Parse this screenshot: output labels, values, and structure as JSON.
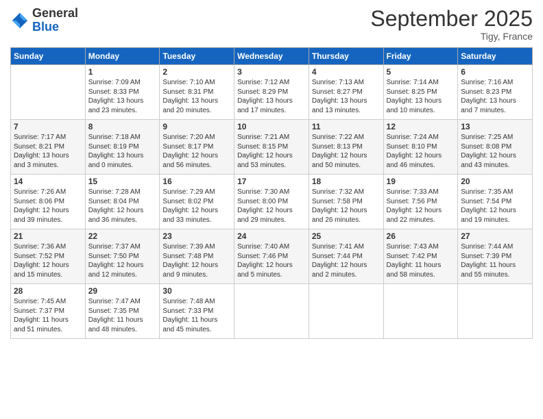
{
  "logo": {
    "general": "General",
    "blue": "Blue"
  },
  "title": "September 2025",
  "location": "Tigy, France",
  "days_header": [
    "Sunday",
    "Monday",
    "Tuesday",
    "Wednesday",
    "Thursday",
    "Friday",
    "Saturday"
  ],
  "weeks": [
    [
      {
        "day": "",
        "text": ""
      },
      {
        "day": "1",
        "text": "Sunrise: 7:09 AM\nSunset: 8:33 PM\nDaylight: 13 hours\nand 23 minutes."
      },
      {
        "day": "2",
        "text": "Sunrise: 7:10 AM\nSunset: 8:31 PM\nDaylight: 13 hours\nand 20 minutes."
      },
      {
        "day": "3",
        "text": "Sunrise: 7:12 AM\nSunset: 8:29 PM\nDaylight: 13 hours\nand 17 minutes."
      },
      {
        "day": "4",
        "text": "Sunrise: 7:13 AM\nSunset: 8:27 PM\nDaylight: 13 hours\nand 13 minutes."
      },
      {
        "day": "5",
        "text": "Sunrise: 7:14 AM\nSunset: 8:25 PM\nDaylight: 13 hours\nand 10 minutes."
      },
      {
        "day": "6",
        "text": "Sunrise: 7:16 AM\nSunset: 8:23 PM\nDaylight: 13 hours\nand 7 minutes."
      }
    ],
    [
      {
        "day": "7",
        "text": "Sunrise: 7:17 AM\nSunset: 8:21 PM\nDaylight: 13 hours\nand 3 minutes."
      },
      {
        "day": "8",
        "text": "Sunrise: 7:18 AM\nSunset: 8:19 PM\nDaylight: 13 hours\nand 0 minutes."
      },
      {
        "day": "9",
        "text": "Sunrise: 7:20 AM\nSunset: 8:17 PM\nDaylight: 12 hours\nand 56 minutes."
      },
      {
        "day": "10",
        "text": "Sunrise: 7:21 AM\nSunset: 8:15 PM\nDaylight: 12 hours\nand 53 minutes."
      },
      {
        "day": "11",
        "text": "Sunrise: 7:22 AM\nSunset: 8:13 PM\nDaylight: 12 hours\nand 50 minutes."
      },
      {
        "day": "12",
        "text": "Sunrise: 7:24 AM\nSunset: 8:10 PM\nDaylight: 12 hours\nand 46 minutes."
      },
      {
        "day": "13",
        "text": "Sunrise: 7:25 AM\nSunset: 8:08 PM\nDaylight: 12 hours\nand 43 minutes."
      }
    ],
    [
      {
        "day": "14",
        "text": "Sunrise: 7:26 AM\nSunset: 8:06 PM\nDaylight: 12 hours\nand 39 minutes."
      },
      {
        "day": "15",
        "text": "Sunrise: 7:28 AM\nSunset: 8:04 PM\nDaylight: 12 hours\nand 36 minutes."
      },
      {
        "day": "16",
        "text": "Sunrise: 7:29 AM\nSunset: 8:02 PM\nDaylight: 12 hours\nand 33 minutes."
      },
      {
        "day": "17",
        "text": "Sunrise: 7:30 AM\nSunset: 8:00 PM\nDaylight: 12 hours\nand 29 minutes."
      },
      {
        "day": "18",
        "text": "Sunrise: 7:32 AM\nSunset: 7:58 PM\nDaylight: 12 hours\nand 26 minutes."
      },
      {
        "day": "19",
        "text": "Sunrise: 7:33 AM\nSunset: 7:56 PM\nDaylight: 12 hours\nand 22 minutes."
      },
      {
        "day": "20",
        "text": "Sunrise: 7:35 AM\nSunset: 7:54 PM\nDaylight: 12 hours\nand 19 minutes."
      }
    ],
    [
      {
        "day": "21",
        "text": "Sunrise: 7:36 AM\nSunset: 7:52 PM\nDaylight: 12 hours\nand 15 minutes."
      },
      {
        "day": "22",
        "text": "Sunrise: 7:37 AM\nSunset: 7:50 PM\nDaylight: 12 hours\nand 12 minutes."
      },
      {
        "day": "23",
        "text": "Sunrise: 7:39 AM\nSunset: 7:48 PM\nDaylight: 12 hours\nand 9 minutes."
      },
      {
        "day": "24",
        "text": "Sunrise: 7:40 AM\nSunset: 7:46 PM\nDaylight: 12 hours\nand 5 minutes."
      },
      {
        "day": "25",
        "text": "Sunrise: 7:41 AM\nSunset: 7:44 PM\nDaylight: 12 hours\nand 2 minutes."
      },
      {
        "day": "26",
        "text": "Sunrise: 7:43 AM\nSunset: 7:42 PM\nDaylight: 11 hours\nand 58 minutes."
      },
      {
        "day": "27",
        "text": "Sunrise: 7:44 AM\nSunset: 7:39 PM\nDaylight: 11 hours\nand 55 minutes."
      }
    ],
    [
      {
        "day": "28",
        "text": "Sunrise: 7:45 AM\nSunset: 7:37 PM\nDaylight: 11 hours\nand 51 minutes."
      },
      {
        "day": "29",
        "text": "Sunrise: 7:47 AM\nSunset: 7:35 PM\nDaylight: 11 hours\nand 48 minutes."
      },
      {
        "day": "30",
        "text": "Sunrise: 7:48 AM\nSunset: 7:33 PM\nDaylight: 11 hours\nand 45 minutes."
      },
      {
        "day": "",
        "text": ""
      },
      {
        "day": "",
        "text": ""
      },
      {
        "day": "",
        "text": ""
      },
      {
        "day": "",
        "text": ""
      }
    ]
  ]
}
